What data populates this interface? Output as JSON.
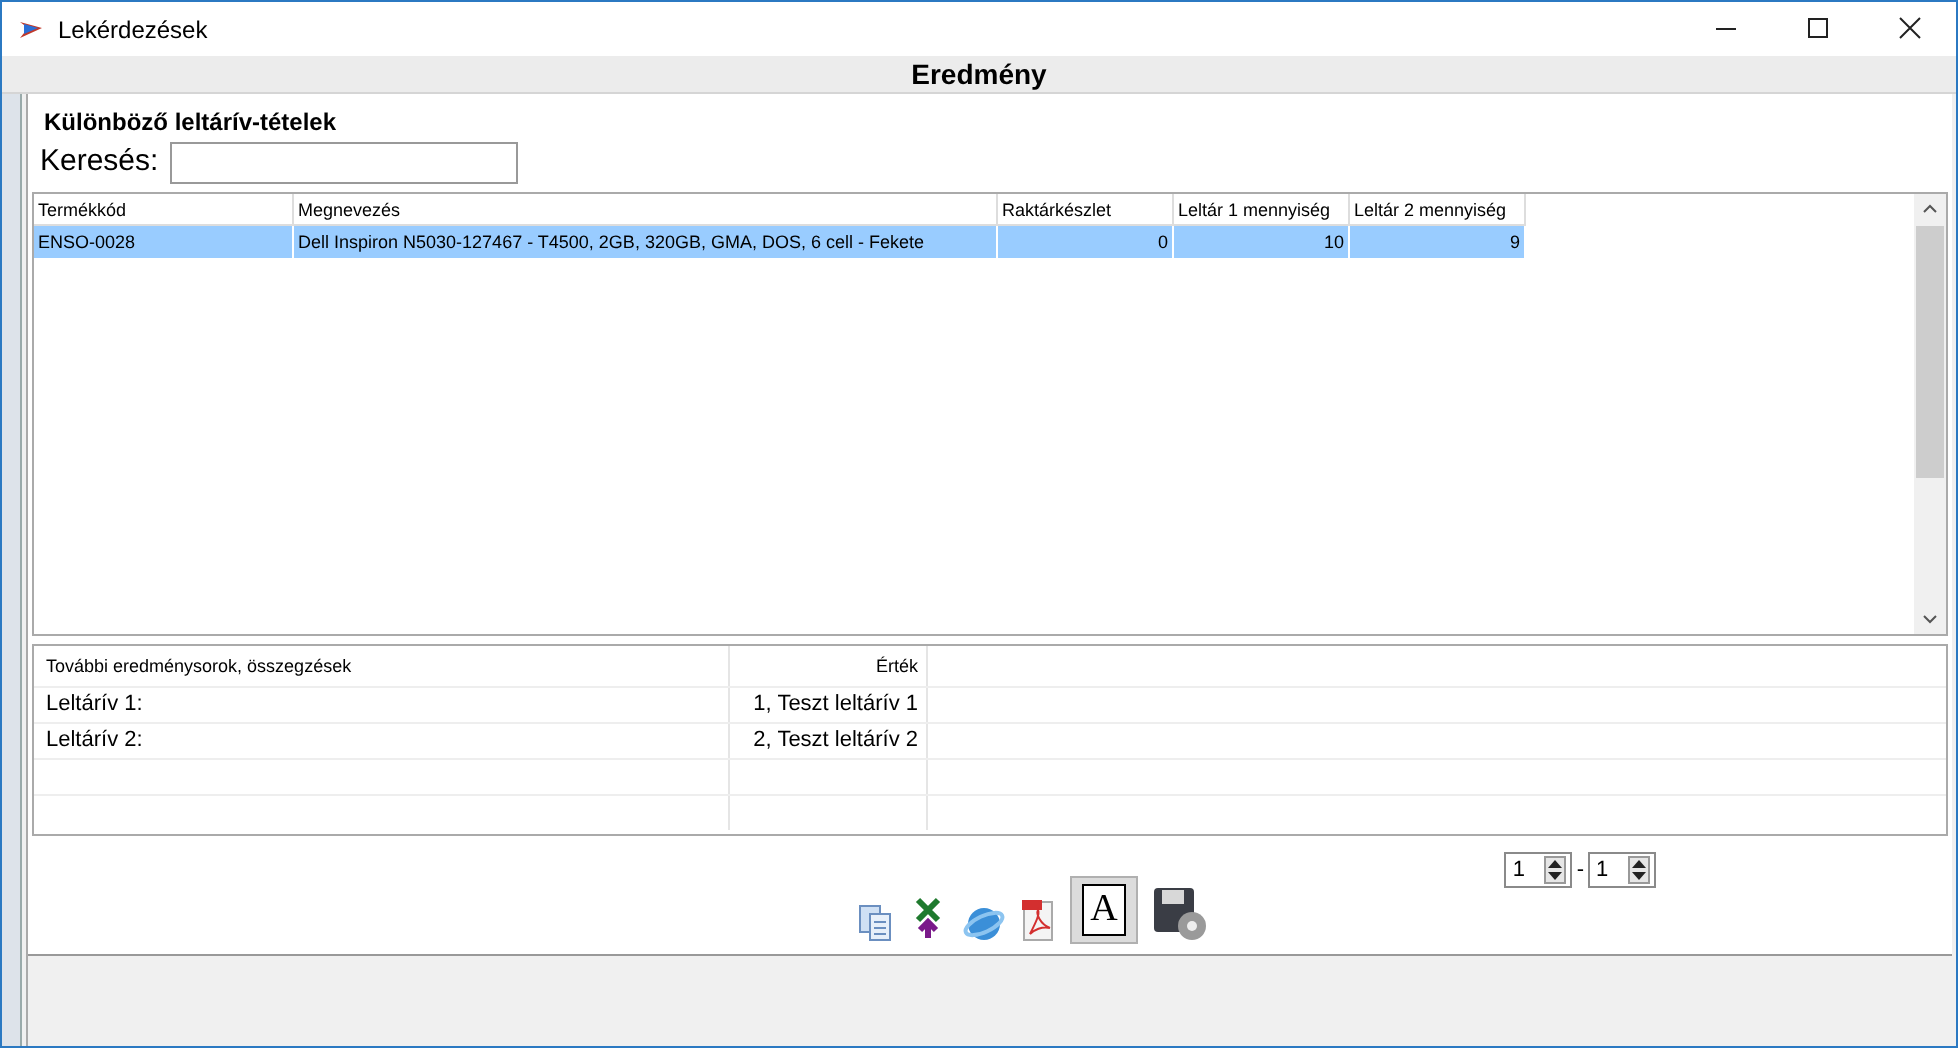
{
  "window": {
    "title": "Lekérdezések"
  },
  "header": "Eredmény",
  "section_title": "Különböző leltárív-tételek",
  "search": {
    "label": "Keresés:"
  },
  "table": {
    "columns": [
      "Termékkód",
      "Megnevezés",
      "Raktárkészlet",
      "Leltár 1 mennyiség",
      "Leltár 2 mennyiség"
    ],
    "rows": [
      {
        "selected": true,
        "cells": [
          "ENSO-0028",
          "Dell Inspiron N5030-127467 - T4500, 2GB, 320GB, GMA, DOS, 6 cell - Fekete",
          "0",
          "10",
          "9"
        ]
      }
    ]
  },
  "summary": {
    "columns": [
      "További eredménysorok, összegzések",
      "Érték"
    ],
    "rows": [
      [
        "Leltárív 1:",
        "1, Teszt leltárív 1"
      ],
      [
        "Leltárív 2:",
        "2, Teszt leltárív 2"
      ]
    ]
  },
  "font_button": {
    "glyph": "A",
    "selected": true
  },
  "page_range": {
    "from": "1",
    "to": "1",
    "separator": "-"
  }
}
